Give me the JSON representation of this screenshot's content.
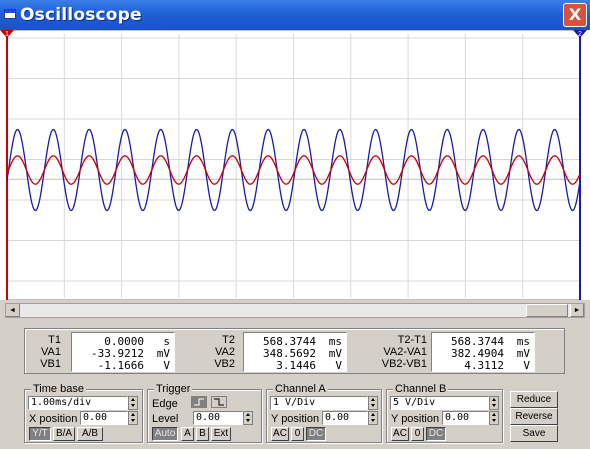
{
  "window": {
    "title": "Oscilloscope",
    "close_label": "X"
  },
  "screen": {
    "marker_t1": "1",
    "marker_t2": "2",
    "colors": {
      "background": "#ffffff",
      "grid": "#d8d8d8",
      "channel_a": "#cc0000",
      "channel_b": "#1a1aa8",
      "cursor_t1": "#cc0000",
      "cursor_t2": "#1a1aa8"
    },
    "channel_a_amplitude_div": 0.35,
    "channel_b_amplitude_div": 1.0,
    "cycles_on_screen": 16
  },
  "scrollbar": {
    "left_icon": "◄",
    "right_icon": "►",
    "position_fraction": 0.93
  },
  "readouts": {
    "t1": {
      "labels": [
        "T1",
        "VA1",
        "VB1"
      ],
      "values": [
        "0.0000",
        "-33.9212",
        "-1.1666"
      ],
      "units": [
        "s",
        "mV",
        "V"
      ]
    },
    "t2": {
      "labels": [
        "T2",
        "VA2",
        "VB2"
      ],
      "values": [
        "568.3744",
        "348.5692",
        "3.1446"
      ],
      "units": [
        "ms",
        "mV",
        "V"
      ]
    },
    "diff": {
      "labels": [
        "T2-T1",
        "VA2-VA1",
        "VB2-VB1"
      ],
      "values": [
        "568.3744",
        "382.4904",
        "4.3112"
      ],
      "units": [
        "ms",
        "mV",
        "V"
      ]
    }
  },
  "timebase": {
    "title": "Time base",
    "scale": "1.00ms/div",
    "xpos_label": "X position",
    "xpos": "0.00",
    "modes": [
      "Y/T",
      "B/A",
      "A/B"
    ]
  },
  "trigger": {
    "title": "Trigger",
    "edge_label": "Edge",
    "level_label": "Level",
    "level": "0.00",
    "modes": [
      "Auto",
      "A",
      "B",
      "Ext"
    ]
  },
  "channel_a": {
    "title": "Channel A",
    "scale": "1  V/Div",
    "ypos_label": "Y position",
    "ypos": "0.00",
    "coupling": [
      "AC",
      "0",
      "DC"
    ]
  },
  "channel_b": {
    "title": "Channel B",
    "scale": "5  V/Div",
    "ypos_label": "Y position",
    "ypos": "0.00",
    "coupling": [
      "AC",
      "0",
      "DC"
    ]
  },
  "actions": {
    "reduce": "Reduce",
    "reverse": "Reverse",
    "save": "Save"
  }
}
